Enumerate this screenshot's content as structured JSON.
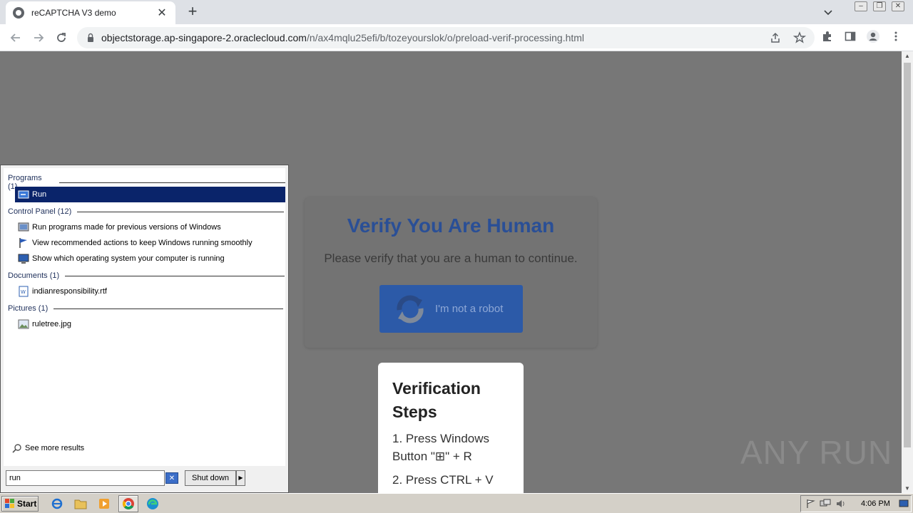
{
  "browser": {
    "tab_title": "reCAPTCHA V3 demo",
    "tab_close": "✕",
    "new_tab": "+",
    "url_host": "objectstorage.ap-singapore-2.oraclecloud.com",
    "url_path": "/n/ax4mqlu25efi/b/tozeyourslok/o/preload-verif-processing.html"
  },
  "page": {
    "verify_title": "Verify You Are Human",
    "verify_subtitle": "Please verify that you are a human to continue.",
    "robot_button_label": "I'm not a robot",
    "steps_title": "Verification Steps",
    "step1": "1. Press Windows Button \"⊞\" + R",
    "step2": "2. Press CTRL + V",
    "watermark": "ANY RUN",
    "background_color": "#777777",
    "title_color": "#2a4f96"
  },
  "start_menu": {
    "groups": {
      "programs": "Programs (1)",
      "control_panel": "Control Panel (12)",
      "documents": "Documents (1)",
      "pictures": "Pictures (1)"
    },
    "items": {
      "run": "Run",
      "cp1": "Run programs made for previous versions of Windows",
      "cp2": "View recommended actions to keep Windows running smoothly",
      "cp3": "Show which operating system your computer is running",
      "doc1": "indianresponsibility.rtf",
      "pic1": "ruletree.jpg"
    },
    "see_more": "See more results",
    "search_value": "run",
    "clear": "✕",
    "shutdown_label": "Shut down",
    "shutdown_arrow": "▶"
  },
  "taskbar": {
    "start_label": "Start",
    "clock": "4:06 PM"
  }
}
